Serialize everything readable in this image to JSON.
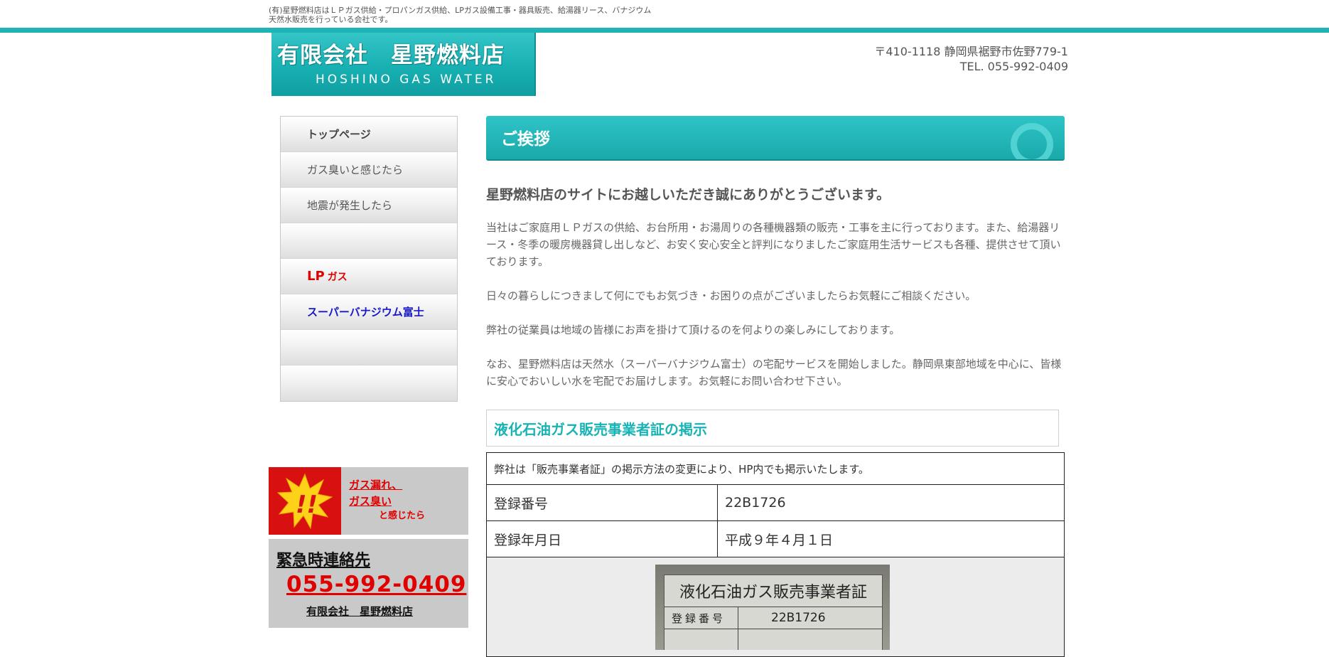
{
  "header": {
    "tagline": "(有)星野燃料店はＬＰガス供給・プロパンガス供給、LPガス設備工事・器具販売、給湯器リース、バナジウム天然水販売を行っている会社です。",
    "logo_jp": "有限会社　星野燃料店",
    "logo_en": "HOSHINO GAS WATER",
    "address": "〒410-1118 静岡県裾野市佐野779-1",
    "tel": "TEL. 055-992-0409",
    "accent_color": "#1fb3b5"
  },
  "sidebar": {
    "items": [
      {
        "label": "トップページ"
      },
      {
        "label": "ガス臭いと感じたら"
      },
      {
        "label": "地震が発生したら"
      },
      {
        "label": ""
      },
      {
        "label": "LP",
        "suffix": "ガス"
      },
      {
        "label": "スーパーバナジウム富士"
      },
      {
        "label": ""
      },
      {
        "label": ""
      }
    ],
    "alert": {
      "line1": "ガス漏れ、",
      "line2": "ガス臭い",
      "line3": "と感じたら",
      "icon": "exclamation-burst-icon"
    },
    "emergency": {
      "title": "緊急時連絡先",
      "phone": "055-992-0409",
      "company": "有限会社　星野燃料店"
    }
  },
  "main": {
    "heading": "ご挨拶",
    "lead": "星野燃料店のサイトにお越しいただき誠にありがとうございます。",
    "paragraphs": [
      "当社はご家庭用ＬＰガスの供給、お台所用・お湯周りの各種機器類の販売・工事を主に行っております。また、給湯器リース・冬季の暖房機器貸し出しなど、お安く安心安全と評判になりましたご家庭用生活サービスも各種、提供させて頂いております。",
      "日々の暮らしにつきまして何にでもお気づき・お困りの点がございましたらお気軽にご相談ください。",
      "弊社の従業員は地域の皆様にお声を掛けて頂けるのを何よりの楽しみにしております。",
      "なお、星野燃料店は天然水（スーパーバナジウム富士）の宅配サービスを開始しました。静岡県東部地域を中心に、皆様に安心でおいしい水を宅配でお届けします。お気軽にお問い合わせ下さい。"
    ],
    "section_heading": "液化石油ガス販売事業者証の掲示",
    "table": {
      "note": "弊社は「販売事業者証」の掲示方法の変更により、HP内でも掲示いたします。",
      "rows": [
        {
          "label": "登録番号",
          "value": "22B1726"
        },
        {
          "label": "登録年月日",
          "value": "平成９年４月１日"
        }
      ],
      "plate": {
        "title": "液化石油ガス販売事業者証",
        "row_label": "登録番号",
        "row_value": "22B1726"
      }
    }
  }
}
